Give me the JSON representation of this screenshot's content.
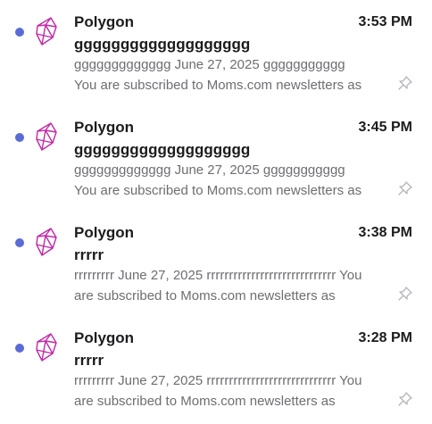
{
  "colors": {
    "unread_dot": "#5b6bd5",
    "avatar_stroke": "#c02aa6",
    "pin": "#b5b5ba"
  },
  "emails": [
    {
      "sender": "Polygon",
      "time": "3:53 PM",
      "subject": "ggggggggggggggggggg",
      "preview_lines": [
        "ggggggggggggg June 27, 2025 ggggggggggg",
        "You are subscribed to Moms.com newsletters as"
      ],
      "unread": true,
      "avatar_icon": "polygon-logo-icon",
      "pin_icon": "pin-icon"
    },
    {
      "sender": "Polygon",
      "time": "3:45 PM",
      "subject": "ggggggggggggggggggg",
      "preview_lines": [
        "ggggggggggggg June 27, 2025 ggggggggggg",
        "You are subscribed to Moms.com newsletters as"
      ],
      "unread": true,
      "avatar_icon": "polygon-logo-icon",
      "pin_icon": "pin-icon"
    },
    {
      "sender": "Polygon",
      "time": "3:38 PM",
      "subject": "rrrrr",
      "preview_lines": [
        "rrrrrrrrr June 27, 2025 rrrrrrrrrrrrrrrrrrrrrrrrrrrrr You",
        "are subscribed to Moms.com newsletters as"
      ],
      "unread": true,
      "avatar_icon": "polygon-logo-icon",
      "pin_icon": "pin-icon"
    },
    {
      "sender": "Polygon",
      "time": "3:28 PM",
      "subject": "rrrrr",
      "preview_lines": [
        "rrrrrrrrr June 27, 2025 rrrrrrrrrrrrrrrrrrrrrrrrrrrrr You",
        "are subscribed to Moms.com newsletters as"
      ],
      "unread": true,
      "avatar_icon": "polygon-logo-icon",
      "pin_icon": "pin-icon"
    }
  ]
}
